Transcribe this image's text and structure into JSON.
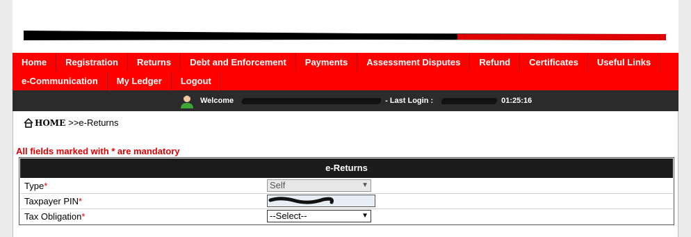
{
  "nav": {
    "row1": [
      "Home",
      "Registration",
      "Returns",
      "Debt and Enforcement",
      "Payments",
      "Assessment Disputes",
      "Refund",
      "Certificates",
      "Useful Links"
    ],
    "row2": [
      "e-Communication",
      "My Ledger",
      "Logout"
    ]
  },
  "welcome": {
    "prefix": "Welcome",
    "login_label": "- Last Login :",
    "login_time": "01:25:16"
  },
  "breadcrumb": {
    "home": "HOME",
    "current": ">>e-Returns"
  },
  "notice": "All fields marked with * are mandatory",
  "form": {
    "title": "e-Returns",
    "fields": [
      {
        "label": "Type",
        "required": "*",
        "value": "Self"
      },
      {
        "label": "Taxpayer PIN",
        "required": "*",
        "value": ""
      },
      {
        "label": "Tax Obligation",
        "required": "*",
        "value": "--Select--"
      }
    ]
  },
  "colors": {
    "nav_bg": "#ff0000",
    "welcome_bg": "#2b2b2b",
    "form_header_bg": "#1c1c1c",
    "required": "#e00000"
  },
  "icons": [
    "home-icon",
    "user-avatar-icon",
    "chevron-down-icon"
  ]
}
